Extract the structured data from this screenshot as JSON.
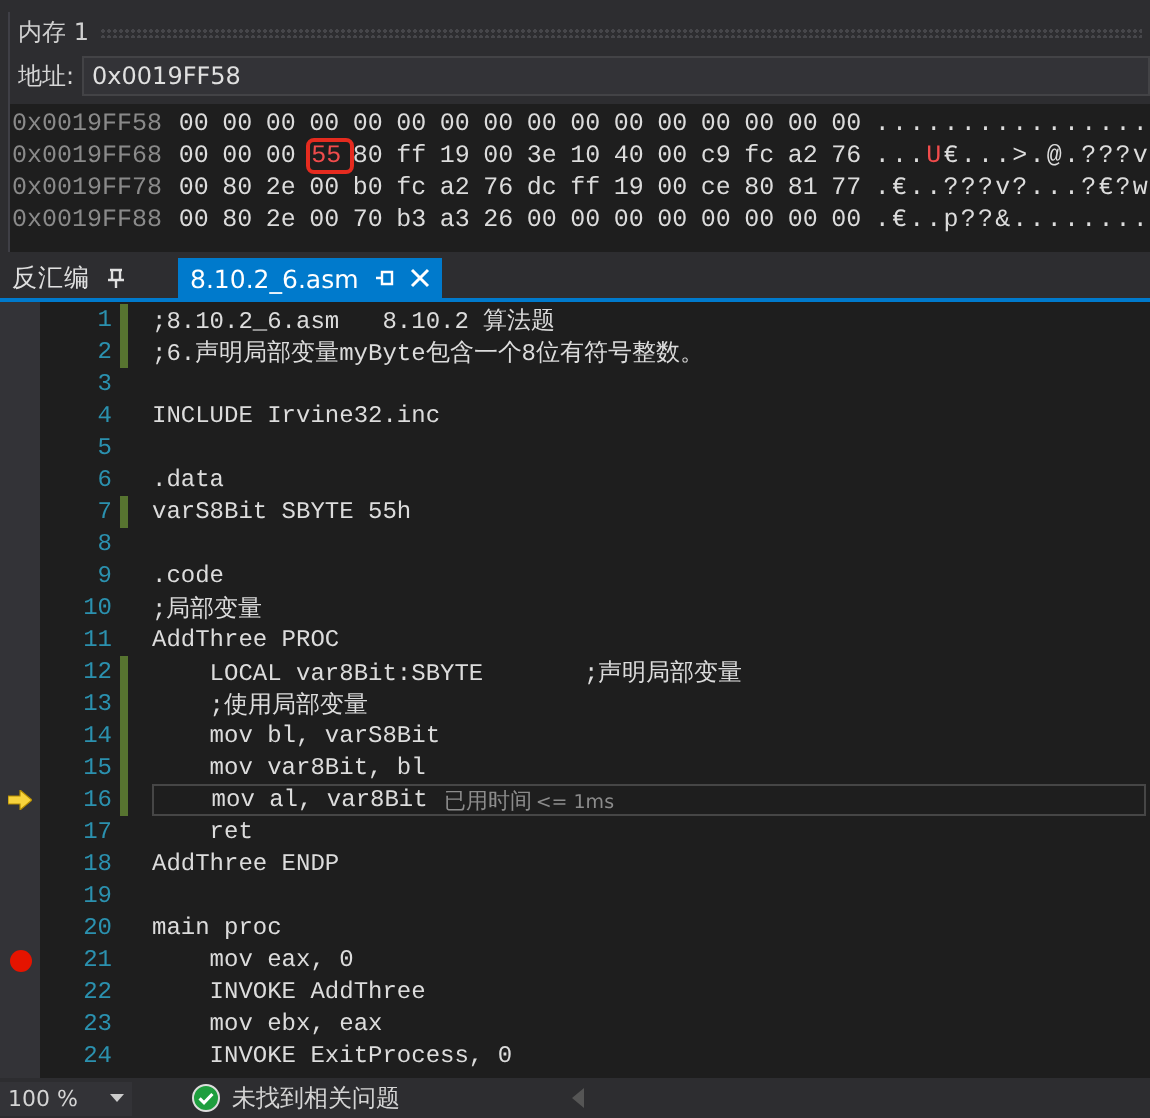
{
  "memory_panel": {
    "title": "内存 1",
    "address_label": "地址:",
    "address_value": "0x0019FF58",
    "rows": [
      {
        "address": "0x0019FF58",
        "bytes": [
          {
            "text": "00",
            "changed": false,
            "boxed": false
          },
          {
            "text": "00",
            "changed": false,
            "boxed": false
          },
          {
            "text": "00",
            "changed": false,
            "boxed": false
          },
          {
            "text": "00",
            "changed": false,
            "boxed": false
          },
          {
            "text": "00",
            "changed": false,
            "boxed": false
          },
          {
            "text": "00",
            "changed": false,
            "boxed": false
          },
          {
            "text": "00",
            "changed": false,
            "boxed": false
          },
          {
            "text": "00",
            "changed": false,
            "boxed": false
          },
          {
            "text": "00",
            "changed": false,
            "boxed": false
          },
          {
            "text": "00",
            "changed": false,
            "boxed": false
          },
          {
            "text": "00",
            "changed": false,
            "boxed": false
          },
          {
            "text": "00",
            "changed": false,
            "boxed": false
          },
          {
            "text": "00",
            "changed": false,
            "boxed": false
          },
          {
            "text": "00",
            "changed": false,
            "boxed": false
          },
          {
            "text": "00",
            "changed": false,
            "boxed": false
          },
          {
            "text": "00",
            "changed": false,
            "boxed": false
          }
        ],
        "ascii": [
          {
            "text": "................",
            "changed": false
          }
        ]
      },
      {
        "address": "0x0019FF68",
        "bytes": [
          {
            "text": "00",
            "changed": false,
            "boxed": false
          },
          {
            "text": "00",
            "changed": false,
            "boxed": false
          },
          {
            "text": "00",
            "changed": false,
            "boxed": false
          },
          {
            "text": "55",
            "changed": true,
            "boxed": true
          },
          {
            "text": "80",
            "changed": false,
            "boxed": false
          },
          {
            "text": "ff",
            "changed": false,
            "boxed": false
          },
          {
            "text": "19",
            "changed": false,
            "boxed": false
          },
          {
            "text": "00",
            "changed": false,
            "boxed": false
          },
          {
            "text": "3e",
            "changed": false,
            "boxed": false
          },
          {
            "text": "10",
            "changed": false,
            "boxed": false
          },
          {
            "text": "40",
            "changed": false,
            "boxed": false
          },
          {
            "text": "00",
            "changed": false,
            "boxed": false
          },
          {
            "text": "c9",
            "changed": false,
            "boxed": false
          },
          {
            "text": "fc",
            "changed": false,
            "boxed": false
          },
          {
            "text": "a2",
            "changed": false,
            "boxed": false
          },
          {
            "text": "76",
            "changed": false,
            "boxed": false
          }
        ],
        "ascii": [
          {
            "text": "...",
            "changed": false
          },
          {
            "text": "U",
            "changed": true
          },
          {
            "text": "€...>.@.???v",
            "changed": false
          }
        ]
      },
      {
        "address": "0x0019FF78",
        "bytes": [
          {
            "text": "00",
            "changed": false,
            "boxed": false
          },
          {
            "text": "80",
            "changed": false,
            "boxed": false
          },
          {
            "text": "2e",
            "changed": false,
            "boxed": false
          },
          {
            "text": "00",
            "changed": false,
            "boxed": false
          },
          {
            "text": "b0",
            "changed": false,
            "boxed": false
          },
          {
            "text": "fc",
            "changed": false,
            "boxed": false
          },
          {
            "text": "a2",
            "changed": false,
            "boxed": false
          },
          {
            "text": "76",
            "changed": false,
            "boxed": false
          },
          {
            "text": "dc",
            "changed": false,
            "boxed": false
          },
          {
            "text": "ff",
            "changed": false,
            "boxed": false
          },
          {
            "text": "19",
            "changed": false,
            "boxed": false
          },
          {
            "text": "00",
            "changed": false,
            "boxed": false
          },
          {
            "text": "ce",
            "changed": false,
            "boxed": false
          },
          {
            "text": "80",
            "changed": false,
            "boxed": false
          },
          {
            "text": "81",
            "changed": false,
            "boxed": false
          },
          {
            "text": "77",
            "changed": false,
            "boxed": false
          }
        ],
        "ascii": [
          {
            "text": ".€..???v?...?€?w",
            "changed": false
          }
        ]
      },
      {
        "address": "0x0019FF88",
        "bytes": [
          {
            "text": "00",
            "changed": false,
            "boxed": false
          },
          {
            "text": "80",
            "changed": false,
            "boxed": false
          },
          {
            "text": "2e",
            "changed": false,
            "boxed": false
          },
          {
            "text": "00",
            "changed": false,
            "boxed": false
          },
          {
            "text": "70",
            "changed": false,
            "boxed": false
          },
          {
            "text": "b3",
            "changed": false,
            "boxed": false
          },
          {
            "text": "a3",
            "changed": false,
            "boxed": false
          },
          {
            "text": "26",
            "changed": false,
            "boxed": false
          },
          {
            "text": "00",
            "changed": false,
            "boxed": false
          },
          {
            "text": "00",
            "changed": false,
            "boxed": false
          },
          {
            "text": "00",
            "changed": false,
            "boxed": false
          },
          {
            "text": "00",
            "changed": false,
            "boxed": false
          },
          {
            "text": "00",
            "changed": false,
            "boxed": false
          },
          {
            "text": "00",
            "changed": false,
            "boxed": false
          },
          {
            "text": "00",
            "changed": false,
            "boxed": false
          },
          {
            "text": "00",
            "changed": false,
            "boxed": false
          }
        ],
        "ascii": [
          {
            "text": ".€..p??&........",
            "changed": false
          }
        ]
      }
    ]
  },
  "tabs": [
    {
      "label": "反汇编",
      "selected": false,
      "closable": false
    },
    {
      "label": "8.10.2_6.asm",
      "selected": true,
      "closable": true
    }
  ],
  "editor": {
    "lines": [
      {
        "number": "1",
        "text": ";8.10.2_6.asm   8.10.2 算法题",
        "modified": true,
        "breakpoint": false,
        "current": false
      },
      {
        "number": "2",
        "text": ";6.声明局部变量myByte包含一个8位有符号整数。",
        "modified": true,
        "breakpoint": false,
        "current": false
      },
      {
        "number": "3",
        "modified": false,
        "breakpoint": false,
        "current": false
      },
      {
        "number": "4",
        "text": "INCLUDE Irvine32.inc",
        "modified": false,
        "breakpoint": false,
        "current": false
      },
      {
        "number": "5",
        "modified": false,
        "breakpoint": false,
        "current": false
      },
      {
        "number": "6",
        "text": ".data",
        "modified": false,
        "breakpoint": false,
        "current": false
      },
      {
        "number": "7",
        "text": "varS8Bit SBYTE 55h",
        "modified": true,
        "breakpoint": false,
        "current": false
      },
      {
        "number": "8",
        "modified": false,
        "breakpoint": false,
        "current": false
      },
      {
        "number": "9",
        "text": ".code",
        "modified": false,
        "breakpoint": false,
        "current": false
      },
      {
        "number": "10",
        "text": ";局部变量",
        "modified": false,
        "breakpoint": false,
        "current": false
      },
      {
        "number": "11",
        "text": "AddThree PROC",
        "modified": false,
        "breakpoint": false,
        "current": false
      },
      {
        "number": "12",
        "text": "    LOCAL var8Bit:SBYTE       ;声明局部变量",
        "modified": true,
        "breakpoint": false,
        "current": false
      },
      {
        "number": "13",
        "text": "    ;使用局部变量",
        "modified": true,
        "breakpoint": false,
        "current": false
      },
      {
        "number": "14",
        "text": "    mov bl, varS8Bit",
        "modified": true,
        "breakpoint": false,
        "current": false
      },
      {
        "number": "15",
        "text": "    mov var8Bit, bl",
        "modified": true,
        "breakpoint": false,
        "current": false
      },
      {
        "number": "16",
        "text": "    mov al, var8Bit",
        "modified": true,
        "breakpoint": false,
        "current": true,
        "hint": "已用时间",
        "hint_value": "<= 1ms"
      },
      {
        "number": "17",
        "text": "    ret",
        "modified": false,
        "breakpoint": false,
        "current": false
      },
      {
        "number": "18",
        "text": "AddThree ENDP",
        "modified": false,
        "breakpoint": false,
        "current": false
      },
      {
        "number": "19",
        "modified": false,
        "breakpoint": false,
        "current": false
      },
      {
        "number": "20",
        "text": "main proc",
        "modified": false,
        "breakpoint": false,
        "current": false
      },
      {
        "number": "21",
        "text": "    mov eax, 0",
        "modified": false,
        "breakpoint": true,
        "current": false
      },
      {
        "number": "22",
        "text": "    INVOKE AddThree",
        "modified": false,
        "breakpoint": false,
        "current": false
      },
      {
        "number": "23",
        "text": "    mov ebx, eax",
        "modified": false,
        "breakpoint": false,
        "current": false
      },
      {
        "number": "24",
        "text": "    INVOKE ExitProcess, 0",
        "modified": false,
        "breakpoint": false,
        "current": false
      }
    ]
  },
  "status_bar": {
    "zoom": "100 %",
    "issues": "未找到相关问题"
  }
}
